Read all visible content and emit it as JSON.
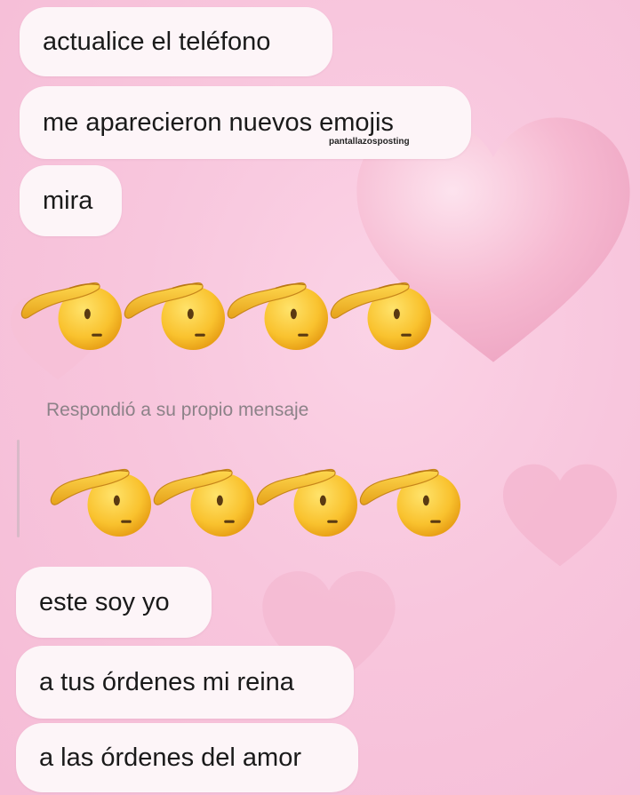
{
  "messages_top": [
    "actualice el teléfono",
    "me aparecieron nuevos emojis",
    "mira"
  ],
  "watermark": "pantallazosposting",
  "emoji_name": "saluting-face-icon",
  "reply": {
    "label": "Respondió a su propio mensaje"
  },
  "messages_bottom": [
    "este soy yo",
    "a tus órdenes mi reina",
    "a las órdenes del amor"
  ],
  "colors": {
    "background": "#f8c6dd",
    "bubble": "#fdf5f8",
    "text": "#1a1a1a",
    "reply_label": "#8c8288"
  }
}
